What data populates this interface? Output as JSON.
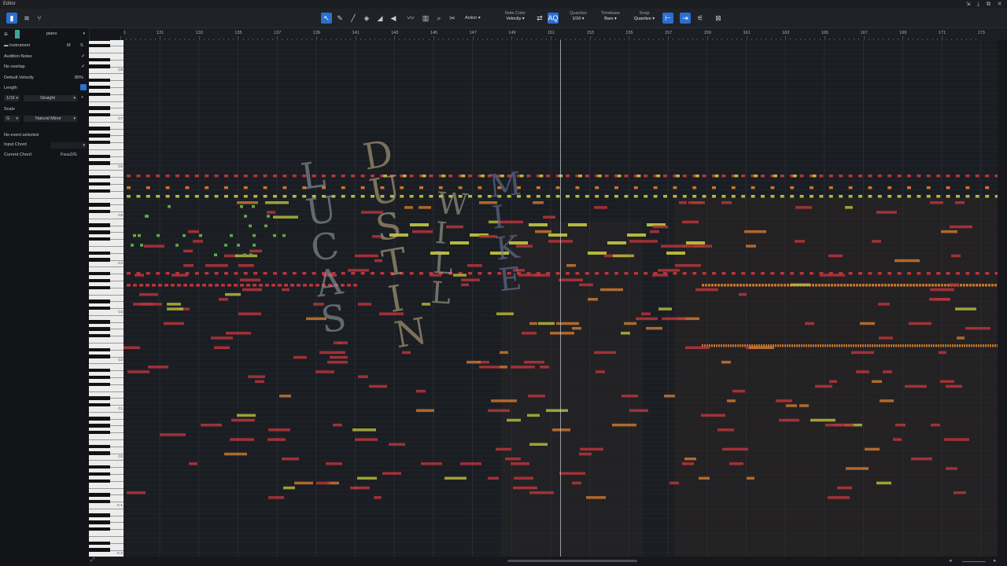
{
  "window": {
    "title": "Editor"
  },
  "toolbar": {
    "action_label": "Action",
    "note_color": {
      "caption": "Note Color",
      "value": "Velocity"
    },
    "quantize": {
      "caption": "Quantize",
      "value": "1/16"
    },
    "timebase": {
      "caption": "Timebase",
      "value": "Bars"
    },
    "snap": {
      "caption": "Snap",
      "value": "Quantize"
    },
    "accent_color": "#2a6fd0"
  },
  "inspector": {
    "track_name": "piano",
    "instrument_label": "Instrument",
    "mute_label": "M",
    "solo_label": "S",
    "audition_notes_label": "Audition Notes",
    "no_overlap_label": "No overlap",
    "default_velocity_label": "Default Velocity",
    "default_velocity_value": "80%",
    "length_label": "Length",
    "length_value": "1/16",
    "length_mode": "Straight",
    "scale_label": "Scale",
    "scale_root": "G",
    "scale_type": "Natural Minor",
    "no_event_label": "No event selected",
    "input_chord_label": "Input Chord",
    "current_chord_label": "Current Chord",
    "current_chord_value": "Fsus2/G"
  },
  "ruler": {
    "bars": [
      "131",
      "133",
      "135",
      "137",
      "139",
      "141",
      "143",
      "145",
      "147",
      "149",
      "151",
      "153",
      "155",
      "157",
      "159",
      "161",
      "163",
      "165",
      "167",
      "169",
      "171",
      "173"
    ]
  },
  "keyboard": {
    "octave_labels": [
      "C8",
      "C7",
      "C6",
      "C5",
      "C4",
      "C3",
      "C2",
      "C1",
      "C0",
      "C-1",
      "C-2"
    ]
  },
  "overlay_text": {
    "lucas": "LUCAS",
    "dustin": "DUSTIN",
    "will": "WILL",
    "mike": "MIKE"
  },
  "note_colors": {
    "red": "#b8343b",
    "orange": "#c8752e",
    "yellow": "#b5b83a",
    "green": "#5faa4a"
  }
}
